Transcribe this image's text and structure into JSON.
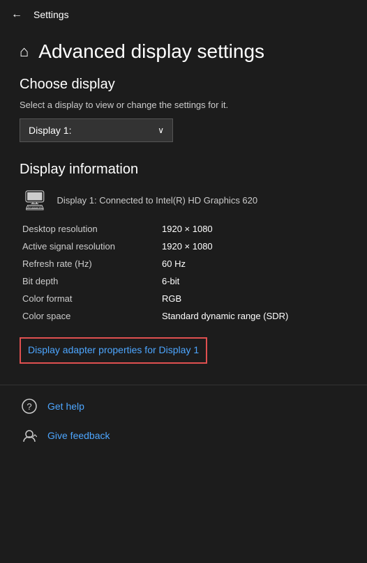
{
  "titleBar": {
    "back": "←",
    "title": "Settings"
  },
  "pageHeader": {
    "homeIcon": "⌂",
    "title": "Advanced display settings"
  },
  "chooseDisplay": {
    "sectionTitle": "Choose display",
    "desc": "Select a display to view or change the settings for it.",
    "dropdownValue": "Display 1:",
    "dropdownChevron": "∨"
  },
  "displayInfo": {
    "sectionTitle": "Display information",
    "monitorIconUnicode": "🖥",
    "connectedText": "Display 1: Connected to Intel(R) HD Graphics 620",
    "rows": [
      {
        "label": "Desktop resolution",
        "value": "1920 × 1080"
      },
      {
        "label": "Active signal resolution",
        "value": "1920 × 1080"
      },
      {
        "label": "Refresh rate (Hz)",
        "value": "60 Hz"
      },
      {
        "label": "Bit depth",
        "value": "6-bit"
      },
      {
        "label": "Color format",
        "value": "RGB"
      },
      {
        "label": "Color space",
        "value": "Standard dynamic range (SDR)"
      }
    ],
    "adapterLinkText": "Display adapter properties for Display 1"
  },
  "footer": {
    "getHelp": "Get help",
    "giveFeedback": "Give feedback"
  },
  "colors": {
    "accent": "#4da6ff",
    "background": "#1c1c1c",
    "adapterBorder": "#e05050"
  }
}
